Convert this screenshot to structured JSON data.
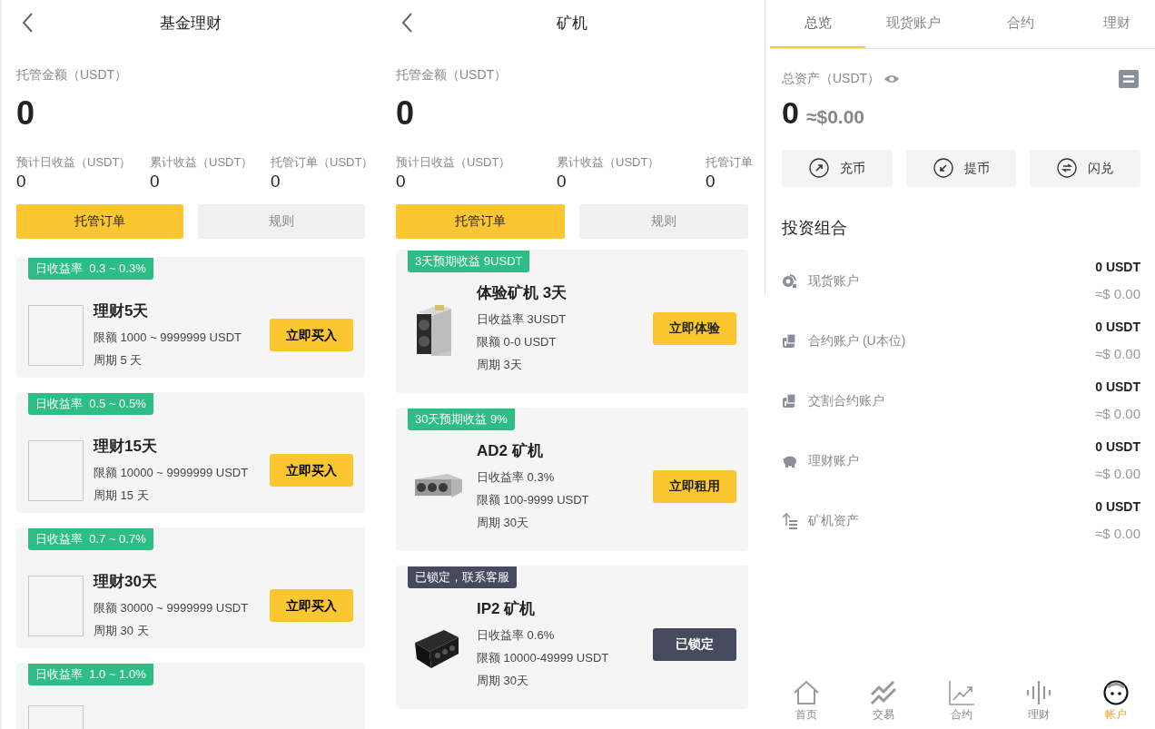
{
  "fund": {
    "title": "基金理财",
    "amount_label": "托管金额（USDT）",
    "amount": "0",
    "stats": [
      {
        "label": "预计日收益（USDT）",
        "value": "0"
      },
      {
        "label": "累计收益（USDT）",
        "value": "0"
      },
      {
        "label": "托管订单（USDT）",
        "value": "0"
      }
    ],
    "tabs": [
      {
        "label": "托管订单",
        "selected": true
      },
      {
        "label": "规则",
        "selected": false
      }
    ],
    "products": [
      {
        "rate": "日收益率  0.3 ~ 0.3%",
        "name": "理财5天",
        "limit": "限额 1000 ~ 9999999 USDT",
        "period": "周期 5 天",
        "button": "立即买入"
      },
      {
        "rate": "日收益率  0.5 ~ 0.5%",
        "name": "理财15天",
        "limit": "限额 10000 ~ 9999999 USDT",
        "period": "周期 15 天",
        "button": "立即买入"
      },
      {
        "rate": "日收益率  0.7 ~ 0.7%",
        "name": "理财30天",
        "limit": "限额 30000 ~ 9999999 USDT",
        "period": "周期 30 天",
        "button": "立即买入"
      },
      {
        "rate": "日收益率  1.0 ~ 1.0%"
      }
    ]
  },
  "miner": {
    "title": "矿机",
    "amount_label": "托管金额（USDT）",
    "amount": "0",
    "stats": [
      {
        "label": "预计日收益（USDT）",
        "value": "0"
      },
      {
        "label": "累计收益（USDT）",
        "value": "0"
      },
      {
        "label": "托管订单",
        "value": "0"
      }
    ],
    "tabs": [
      {
        "label": "托管订单",
        "selected": true
      },
      {
        "label": "规则",
        "selected": false
      }
    ],
    "products": [
      {
        "tag": "3天预期收益 9USDT",
        "locked": false,
        "name": "体验矿机 3天",
        "lines": [
          "日收益率 3USDT",
          "限额 0-0 USDT",
          "周期 3天"
        ],
        "button": "立即体验"
      },
      {
        "tag": "30天预期收益 9%",
        "locked": false,
        "name": "AD2 矿机",
        "lines": [
          "日收益率 0.3%",
          "限额 100-9999 USDT",
          "周期 30天"
        ],
        "button": "立即租用"
      },
      {
        "tag": "已锁定，联系客服",
        "locked": true,
        "name": "IP2 矿机",
        "lines": [
          "日收益率 0.6%",
          "限额 10000-49999 USDT",
          "周期 30天"
        ],
        "button": "已锁定"
      }
    ]
  },
  "account": {
    "tabs": [
      {
        "label": "总览",
        "selected": true
      },
      {
        "label": "现货账户",
        "selected": false
      },
      {
        "label": "合约",
        "selected": false
      },
      {
        "label": "理财",
        "selected": false
      }
    ],
    "total_label": "总资产（USDT）",
    "total": "0",
    "total_usd": "≈$0.00",
    "actions": [
      {
        "label": "充币",
        "kind": "deposit"
      },
      {
        "label": "提币",
        "kind": "withdraw"
      },
      {
        "label": "闪兑",
        "kind": "swap"
      }
    ],
    "portfolio_title": "投资组合",
    "accounts": [
      {
        "kind": "spot",
        "name": "现货账户",
        "amount": "0 USDT",
        "usd": "≈$ 0.00"
      },
      {
        "kind": "contract",
        "name": "合约账户 (U本位)",
        "amount": "0 USDT",
        "usd": "≈$ 0.00"
      },
      {
        "kind": "delivery",
        "name": "交割合约账户",
        "amount": "0 USDT",
        "usd": "≈$ 0.00"
      },
      {
        "kind": "finance",
        "name": "理财账户",
        "amount": "0 USDT",
        "usd": "≈$ 0.00"
      },
      {
        "kind": "miner",
        "name": "矿机资产",
        "amount": "0 USDT",
        "usd": "≈$ 0.00"
      }
    ]
  },
  "nav": [
    {
      "kind": "home",
      "label": "首页",
      "selected": false
    },
    {
      "kind": "trade",
      "label": "交易",
      "selected": false
    },
    {
      "kind": "contract",
      "label": "合约",
      "selected": false
    },
    {
      "kind": "finance",
      "label": "理财",
      "selected": false
    },
    {
      "kind": "account",
      "label": "帐户",
      "selected": true
    }
  ]
}
